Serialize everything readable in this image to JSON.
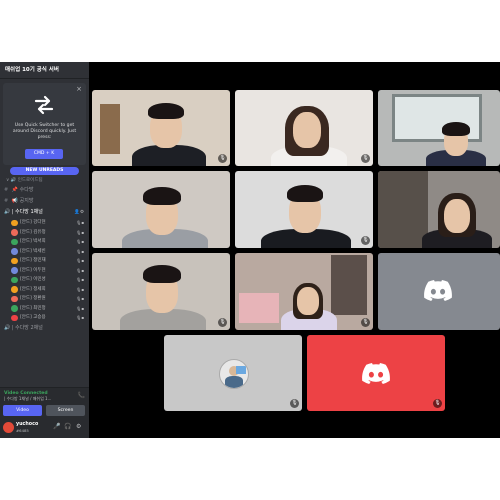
{
  "server": {
    "name": "매쉬업 10기 공식 서버"
  },
  "quick_switcher": {
    "text": "Use Quick Switcher to get around Discord quickly. Just press:",
    "shortcut": "CMD + K",
    "close": "×"
  },
  "new_unreads": "NEW UNREADS",
  "category": "∨ 🔊 인드로이드팀",
  "channels": [
    {
      "prefix": "#",
      "icon": "📌",
      "label": "수다방"
    },
    {
      "prefix": "#",
      "icon": "📢",
      "label": "공지방"
    },
    {
      "prefix": "🔊",
      "label": "| 수다방 1채널"
    },
    {
      "prefix": "🔊",
      "label": "| 수다방 2채널"
    }
  ],
  "voice_users": [
    {
      "name": "[안드] 강다현",
      "color": "#f0a020"
    },
    {
      "name": "[안드] 김유정",
      "color": "#ed6a5a"
    },
    {
      "name": "[안드] 박서희",
      "color": "#3ba55d"
    },
    {
      "name": "[안드] 박세빈",
      "color": "#7289da"
    },
    {
      "name": "[안드] 정민재",
      "color": "#f0a020"
    },
    {
      "name": "[안드] 이두현",
      "color": "#7289da"
    },
    {
      "name": "[안드] 이민성",
      "color": "#3ba55d"
    },
    {
      "name": "[안드] 정세희",
      "color": "#f0a020"
    },
    {
      "name": "[안드] 정환원",
      "color": "#ed6a5a"
    },
    {
      "name": "[안드] 최민정",
      "color": "#3ba55d"
    },
    {
      "name": "[안드] 고승용",
      "color": "#ed4245"
    }
  ],
  "voice_status": {
    "title": "Video Connected",
    "channel": "| 수다방 1채널 / 매쉬업 1...",
    "video_label": "Video",
    "screen_label": "Screen"
  },
  "user_panel": {
    "name": "yuchoco",
    "tag": "#6485"
  },
  "icons": {
    "mic": "🎤",
    "headset": "🎧",
    "gear": "⚙",
    "phone": "📞",
    "mute": "🎙"
  },
  "colors": {
    "discord_blurple": "#5865f2",
    "discord_red": "#ed4245",
    "tile_gray": "#858990",
    "tile_light": "#c8c8c8"
  }
}
